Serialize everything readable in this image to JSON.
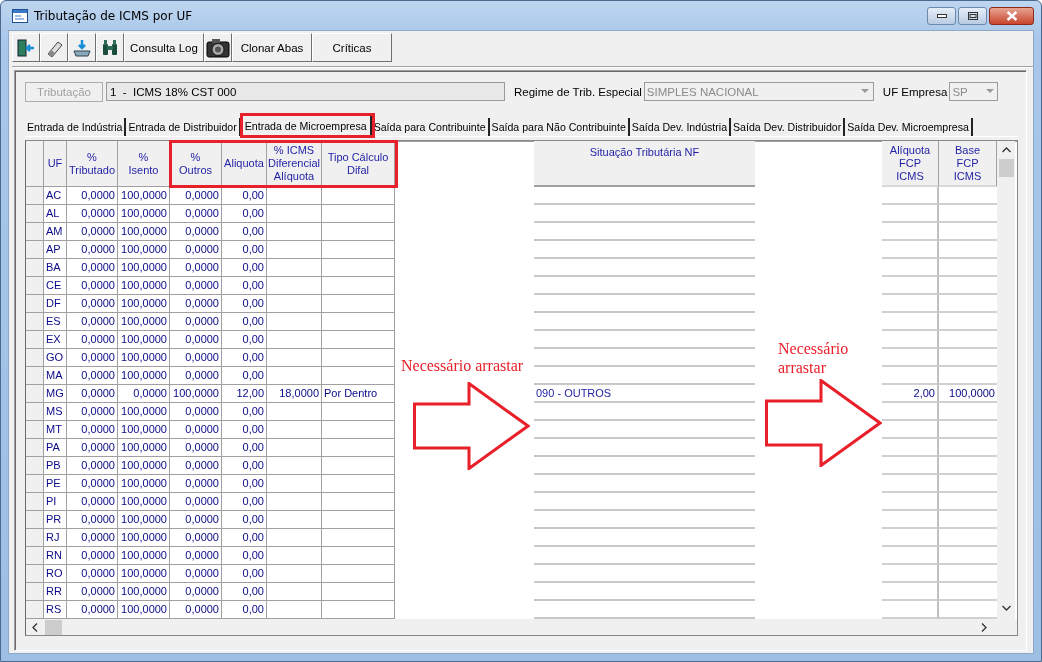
{
  "window": {
    "title": "Tributação de ICMS por UF"
  },
  "toolbar_buttons": [
    "Consulta Log",
    "Clonar Abas",
    "Críticas"
  ],
  "tributacao": {
    "button": {
      "label": "Tributação",
      "disabled": true
    },
    "value": "1  -  ICMS 18% CST 000"
  },
  "regime": {
    "label": "Regime de Trib. Especial",
    "value": "SIMPLES NACIONAL",
    "disabled": true
  },
  "uf_empresa": {
    "label": "UF Empresa",
    "value": "SP",
    "disabled": true
  },
  "tabs": [
    {
      "label": "Entrada de Indústria",
      "selected": false,
      "highlighted": false
    },
    {
      "label": "Entrada de Distribuidor",
      "selected": false,
      "highlighted": false
    },
    {
      "label": "Entrada de Microempresa",
      "selected": true,
      "highlighted": true
    },
    {
      "label": "Saída para Contribuinte",
      "selected": false,
      "highlighted": false
    },
    {
      "label": "Saída para Não Contribuinte",
      "selected": false,
      "highlighted": false
    },
    {
      "label": "Saída Dev. Indústria",
      "selected": false,
      "highlighted": false
    },
    {
      "label": "Saída Dev. Distribuidor",
      "selected": false,
      "highlighted": false
    },
    {
      "label": "Saída Dev. Microempresa",
      "selected": false,
      "highlighted": false
    }
  ],
  "columns": [
    {
      "label": "UF",
      "highlighted": false
    },
    {
      "label": "% Tributado",
      "highlighted": false
    },
    {
      "label": "% Isento",
      "highlighted": false
    },
    {
      "label": "% Outros",
      "highlighted": true
    },
    {
      "label": "Aliquota",
      "highlighted": true
    },
    {
      "label": "% ICMS Diferencial Alíquota",
      "highlighted": true
    },
    {
      "label": "Tipo Cálculo Difal",
      "highlighted": true
    }
  ],
  "middle_column": {
    "label": "Situação Tributária NF"
  },
  "right_columns": [
    {
      "label": "Alíquota FCP ICMS"
    },
    {
      "label": "Base FCP ICMS"
    }
  ],
  "rows": [
    {
      "uf": "AC",
      "tributado": "0,0000",
      "isento": "100,0000",
      "outros": "0,0000",
      "aliquota": "0,00"
    },
    {
      "uf": "AL",
      "tributado": "0,0000",
      "isento": "100,0000",
      "outros": "0,0000",
      "aliquota": "0,00"
    },
    {
      "uf": "AM",
      "tributado": "0,0000",
      "isento": "100,0000",
      "outros": "0,0000",
      "aliquota": "0,00"
    },
    {
      "uf": "AP",
      "tributado": "0,0000",
      "isento": "100,0000",
      "outros": "0,0000",
      "aliquota": "0,00"
    },
    {
      "uf": "BA",
      "tributado": "0,0000",
      "isento": "100,0000",
      "outros": "0,0000",
      "aliquota": "0,00"
    },
    {
      "uf": "CE",
      "tributado": "0,0000",
      "isento": "100,0000",
      "outros": "0,0000",
      "aliquota": "0,00"
    },
    {
      "uf": "DF",
      "tributado": "0,0000",
      "isento": "100,0000",
      "outros": "0,0000",
      "aliquota": "0,00"
    },
    {
      "uf": "ES",
      "tributado": "0,0000",
      "isento": "100,0000",
      "outros": "0,0000",
      "aliquota": "0,00"
    },
    {
      "uf": "EX",
      "tributado": "0,0000",
      "isento": "100,0000",
      "outros": "0,0000",
      "aliquota": "0,00"
    },
    {
      "uf": "GO",
      "tributado": "0,0000",
      "isento": "100,0000",
      "outros": "0,0000",
      "aliquota": "0,00"
    },
    {
      "uf": "MA",
      "tributado": "0,0000",
      "isento": "100,0000",
      "outros": "0,0000",
      "aliquota": "0,00"
    },
    {
      "uf": "MG",
      "tributado": "0,0000",
      "isento": "0,0000",
      "outros": "100,0000",
      "aliquota": "12,00",
      "icms_diferencial": "18,0000",
      "tipo_calculo": "Por Dentro",
      "situacao": "090 - OUTROS",
      "aliquota_fcp": "2,00",
      "base_fcp": "100,0000"
    },
    {
      "uf": "MS",
      "tributado": "0,0000",
      "isento": "100,0000",
      "outros": "0,0000",
      "aliquota": "0,00"
    },
    {
      "uf": "MT",
      "tributado": "0,0000",
      "isento": "100,0000",
      "outros": "0,0000",
      "aliquota": "0,00"
    },
    {
      "uf": "PA",
      "tributado": "0,0000",
      "isento": "100,0000",
      "outros": "0,0000",
      "aliquota": "0,00"
    },
    {
      "uf": "PB",
      "tributado": "0,0000",
      "isento": "100,0000",
      "outros": "0,0000",
      "aliquota": "0,00"
    },
    {
      "uf": "PE",
      "tributado": "0,0000",
      "isento": "100,0000",
      "outros": "0,0000",
      "aliquota": "0,00"
    },
    {
      "uf": "PI",
      "tributado": "0,0000",
      "isento": "100,0000",
      "outros": "0,0000",
      "aliquota": "0,00"
    },
    {
      "uf": "PR",
      "tributado": "0,0000",
      "isento": "100,0000",
      "outros": "0,0000",
      "aliquota": "0,00"
    },
    {
      "uf": "RJ",
      "tributado": "0,0000",
      "isento": "100,0000",
      "outros": "0,0000",
      "aliquota": "0,00"
    },
    {
      "uf": "RN",
      "tributado": "0,0000",
      "isento": "100,0000",
      "outros": "0,0000",
      "aliquota": "0,00"
    },
    {
      "uf": "RO",
      "tributado": "0,0000",
      "isento": "100,0000",
      "outros": "0,0000",
      "aliquota": "0,00"
    },
    {
      "uf": "RR",
      "tributado": "0,0000",
      "isento": "100,0000",
      "outros": "0,0000",
      "aliquota": "0,00"
    },
    {
      "uf": "RS",
      "tributado": "0,0000",
      "isento": "100,0000",
      "outros": "0,0000",
      "aliquota": "0,00"
    }
  ],
  "annotations": [
    {
      "text": "Necessário arrastar"
    },
    {
      "text": "Necessário arrastar"
    }
  ]
}
